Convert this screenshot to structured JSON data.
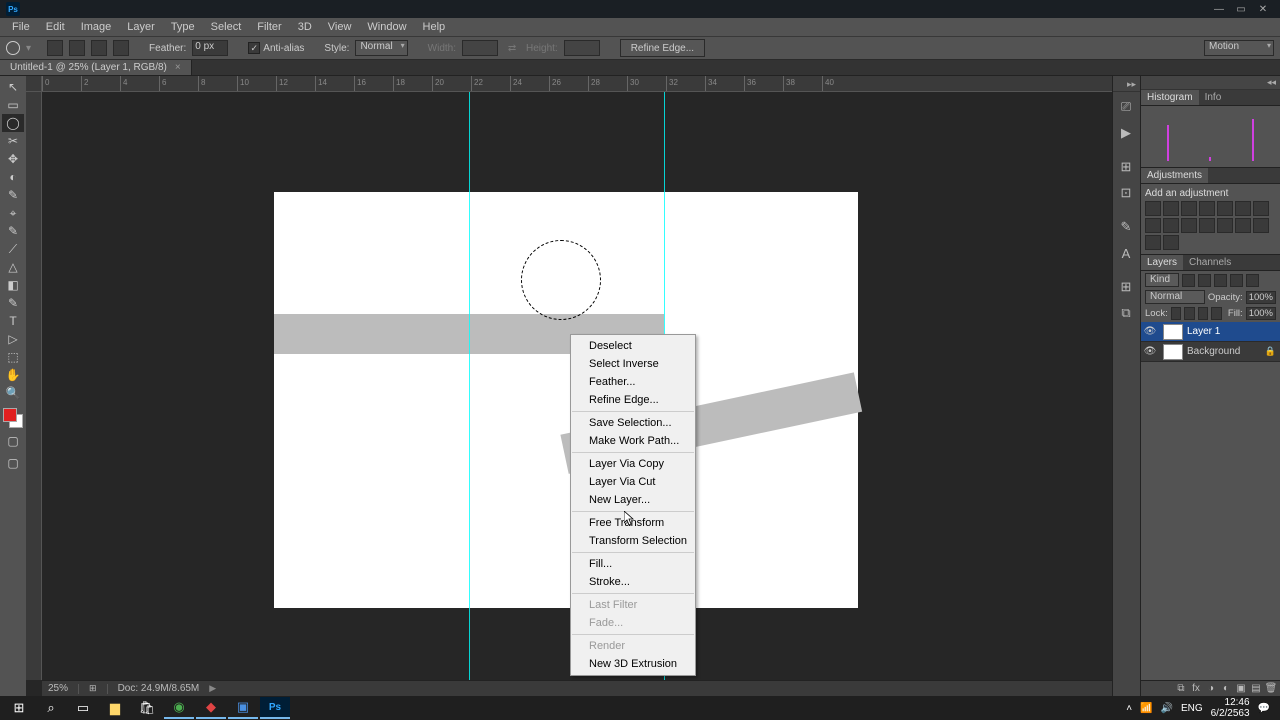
{
  "app": {
    "logo": "Ps"
  },
  "window_controls": {
    "min": "—",
    "max": "▭",
    "close": "✕"
  },
  "menu": [
    "File",
    "Edit",
    "Image",
    "Layer",
    "Type",
    "Select",
    "Filter",
    "3D",
    "View",
    "Window",
    "Help"
  ],
  "options_bar": {
    "feather_label": "Feather:",
    "feather_value": "0 px",
    "anti_alias": "Anti-alias",
    "style_label": "Style:",
    "style_value": "Normal",
    "width_label": "Width:",
    "height_label": "Height:",
    "refine_edge": "Refine Edge...",
    "workspace": "Motion"
  },
  "document_tab": {
    "title": "Untitled-1 @ 25% (Layer 1, RGB/8)",
    "close": "×"
  },
  "ruler_ticks": [
    "0",
    "2",
    "4",
    "6",
    "8",
    "10",
    "12",
    "14",
    "16",
    "18",
    "20",
    "22",
    "24",
    "26",
    "28",
    "30",
    "32",
    "34",
    "36",
    "38",
    "40"
  ],
  "statusbar": {
    "zoom": "25%",
    "doc": "Doc: 24.9M/8.65M",
    "arrow": "▶"
  },
  "context_menu": {
    "items": [
      {
        "label": "Deselect",
        "disabled": false
      },
      {
        "label": "Select Inverse",
        "disabled": false
      },
      {
        "label": "Feather...",
        "disabled": false
      },
      {
        "label": "Refine Edge...",
        "disabled": false
      },
      {
        "sep": true
      },
      {
        "label": "Save Selection...",
        "disabled": false
      },
      {
        "label": "Make Work Path...",
        "disabled": false
      },
      {
        "sep": true
      },
      {
        "label": "Layer Via Copy",
        "disabled": false
      },
      {
        "label": "Layer Via Cut",
        "disabled": false
      },
      {
        "label": "New Layer...",
        "disabled": false
      },
      {
        "sep": true
      },
      {
        "label": "Free Transform",
        "disabled": false
      },
      {
        "label": "Transform Selection",
        "disabled": false
      },
      {
        "sep": true
      },
      {
        "label": "Fill...",
        "disabled": false
      },
      {
        "label": "Stroke...",
        "disabled": false
      },
      {
        "sep": true
      },
      {
        "label": "Last Filter",
        "disabled": true
      },
      {
        "label": "Fade...",
        "disabled": true
      },
      {
        "sep": true
      },
      {
        "label": "Render",
        "disabled": true
      },
      {
        "label": "New 3D Extrusion",
        "disabled": false
      }
    ]
  },
  "panels": {
    "histogram_tab": "Histogram",
    "info_tab": "Info",
    "adjustments_tab": "Adjustments",
    "add_adjustment": "Add an adjustment",
    "layers_tab": "Layers",
    "channels_tab": "Channels",
    "kind_label": "Kind",
    "blend_mode": "Normal",
    "opacity_label": "Opacity:",
    "opacity_value": "100%",
    "lock_label": "Lock:",
    "fill_label": "Fill:",
    "fill_value": "100%",
    "layers": [
      {
        "name": "Layer 1",
        "selected": true,
        "locked": false
      },
      {
        "name": "Background",
        "selected": false,
        "locked": true
      }
    ]
  },
  "tools": [
    "↖",
    "▭",
    "◯",
    "✂",
    "✥",
    "◐",
    "✎",
    "⌖",
    "✎",
    "⟋",
    "△",
    "◧",
    "✎",
    "T",
    "▷",
    "⬚",
    "✋",
    "🔍"
  ],
  "dock_icons": [
    "⎚",
    "▶",
    "⊞",
    "⊡",
    "✎",
    "A",
    "⊞",
    "⧉"
  ],
  "taskbar": {
    "time": "12:46",
    "date": "6/2/2563",
    "lang": "ENG"
  }
}
